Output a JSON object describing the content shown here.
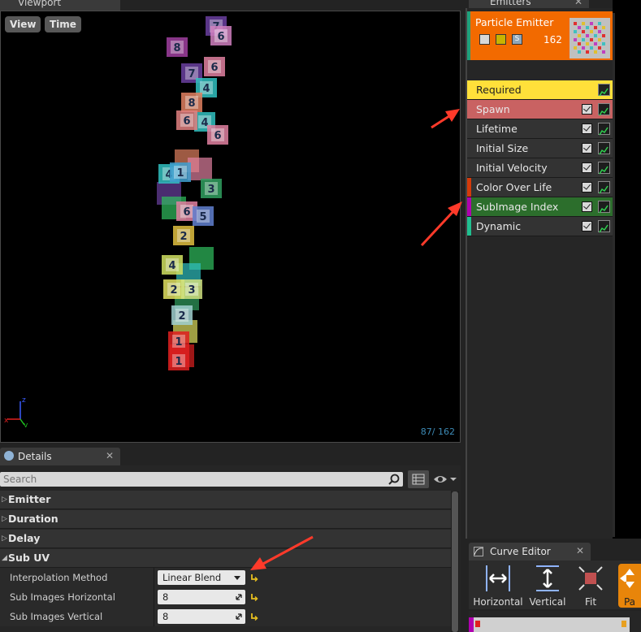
{
  "viewport": {
    "tab_label": "Viewport",
    "view_button": "View",
    "time_button": "Time",
    "particle_count": "87/ 162"
  },
  "particles": [
    "7",
    "6",
    "8",
    "6",
    "7",
    "4",
    "8",
    "4",
    "6",
    "6",
    "4",
    "1",
    "3",
    "6",
    "5",
    "2",
    "4",
    "2",
    "3",
    "2",
    "1",
    "1"
  ],
  "details": {
    "tab_label": "Details",
    "search_placeholder": "Search",
    "categories": {
      "emitter": "Emitter",
      "duration": "Duration",
      "delay": "Delay",
      "subuv": "Sub UV"
    },
    "properties": {
      "interpolation_label": "Interpolation Method",
      "interpolation_value": "Linear Blend",
      "horizontal_label": "Sub Images Horizontal",
      "horizontal_value": "8",
      "vertical_label": "Sub Images Vertical",
      "vertical_value": "8"
    }
  },
  "emitters": {
    "tab_label": "Emitters",
    "emitter_name": "Particle Emitter",
    "emitter_count": "162",
    "icon_s_label": "S",
    "modules": {
      "required": "Required",
      "spawn": "Spawn",
      "lifetime": "Lifetime",
      "initial_size": "Initial Size",
      "initial_velocity": "Initial Velocity",
      "color_over_life": "Color Over Life",
      "subimage_index": "SubImage Index",
      "dynamic": "Dynamic"
    }
  },
  "curve_editor": {
    "tab_label": "Curve Editor",
    "horizontal": "Horizontal",
    "vertical": "Vertical",
    "fit": "Fit",
    "pan": "Pa"
  },
  "colors": {
    "emitter_orange": "#f26a00",
    "required_yellow": "#ffe03a",
    "spawn_red": "#c96262",
    "subimage_green": "#2c6e2c",
    "annotation_arrow": "#ff3a2a"
  }
}
